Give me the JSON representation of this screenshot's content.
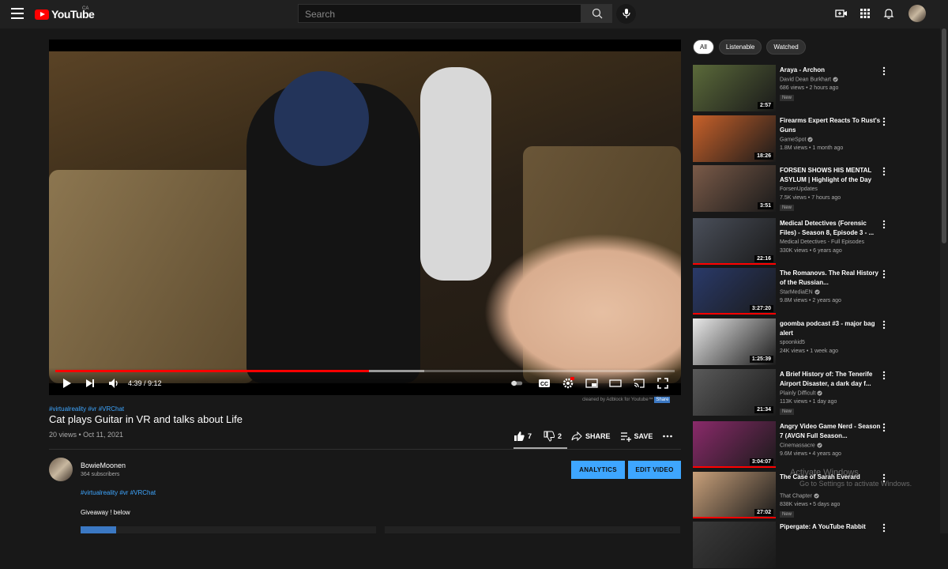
{
  "header": {
    "logo_text": "YouTube",
    "country": "CA",
    "search_placeholder": "Search"
  },
  "player": {
    "time": "4:39 / 9:12",
    "progress": 0.506,
    "adblock_text": "cleaned by Adblock for Youtube™",
    "adblock_share": "Share"
  },
  "video": {
    "tags": "#virtualreality #vr #VRChat",
    "title": "Cat plays Guitar in VR and talks about Life",
    "meta": "20 views • Oct 11, 2021",
    "likes": "7",
    "dislikes": "2",
    "share_label": "SHARE",
    "save_label": "SAVE"
  },
  "channel": {
    "name": "BowieMoonen",
    "subs": "364 subscribers",
    "analytics_label": "ANALYTICS",
    "edit_label": "EDIT VIDEO"
  },
  "description": {
    "tags": "#virtualreality #vr #VRChat",
    "line": "Giveaway ! below"
  },
  "chips": [
    "All",
    "Listenable",
    "Watched"
  ],
  "recommendations": [
    {
      "title": "Araya - Archon",
      "channel": "David Dean Burkhart",
      "verified": true,
      "views": "686 views • 2 hours ago",
      "new": "New",
      "duration": "2:57",
      "color": "#5b6a3a",
      "watched": 0
    },
    {
      "title": "Firearms Expert Reacts To Rust's Guns",
      "channel": "GameSpot",
      "verified": true,
      "views": "1.8M views • 1 month ago",
      "new": "",
      "duration": "18:26",
      "color": "#c8612a",
      "watched": 0
    },
    {
      "title": "FORSEN SHOWS HIS MENTAL ASYLUM | Highlight of the Day",
      "channel": "ForsenUpdates",
      "verified": false,
      "views": "7.5K views • 7 hours ago",
      "new": "New",
      "duration": "3:51",
      "color": "#7a5a48",
      "watched": 0
    },
    {
      "title": "Medical Detectives (Forensic Files) - Season 8, Episode 3 - ...",
      "channel": "Medical Detectives - Full Episodes",
      "verified": false,
      "views": "330K views • 6 years ago",
      "new": "",
      "duration": "22:16",
      "color": "#4a4f5a",
      "watched": 1
    },
    {
      "title": "The Romanovs. The Real History of the Russian...",
      "channel": "StarMediaEN",
      "verified": true,
      "views": "9.8M views • 2 years ago",
      "new": "",
      "duration": "3:27:20",
      "color": "#2a3a6a",
      "watched": 1
    },
    {
      "title": "goomba podcast #3 - major bag alert",
      "channel": "spoonkid5",
      "verified": false,
      "views": "24K views • 1 week ago",
      "new": "",
      "duration": "1:25:39",
      "color": "#e8e8e8",
      "watched": 0
    },
    {
      "title": "A Brief History of: The Tenerife Airport Disaster, a dark day f...",
      "channel": "Plainly Difficult",
      "verified": true,
      "views": "113K views • 1 day ago",
      "new": "New",
      "duration": "21:34",
      "color": "#5a5a5a",
      "watched": 0
    },
    {
      "title": "Angry Video Game Nerd - Season 7 (AVGN Full Season...",
      "channel": "Cinemassacre",
      "verified": true,
      "views": "9.6M views • 4 years ago",
      "new": "",
      "duration": "3:04:07",
      "color": "#8a2a6a",
      "watched": 1
    },
    {
      "title": "The Case of Sarah Everard",
      "channel": "That Chapter",
      "verified": true,
      "views": "838K views • 5 days ago",
      "new": "New",
      "duration": "27:02",
      "color": "#c8a07a",
      "watched": 1
    },
    {
      "title": "Pipergate: A YouTube Rabbit",
      "channel": "",
      "verified": false,
      "views": "",
      "new": "",
      "duration": "",
      "color": "#3a3a3a",
      "watched": 0
    }
  ],
  "watermark": {
    "line1": "Activate Windows",
    "line2": "Go to Settings to activate Windows."
  }
}
